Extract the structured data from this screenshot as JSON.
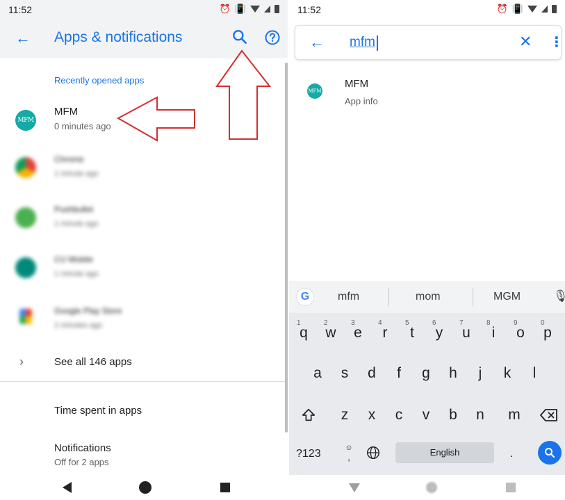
{
  "left_screen": {
    "status_bar": {
      "time": "11:52"
    },
    "app_bar": {
      "title": "Apps & notifications"
    },
    "section_label": "Recently opened apps",
    "recent_apps": [
      {
        "name": "MFM",
        "subtitle": "0 minutes ago",
        "icon": "mfm-icon",
        "icon_text": "MFM",
        "color": "#14aaa6"
      },
      {
        "name": "Chrome",
        "subtitle": "1 minute ago",
        "icon": "chrome-icon",
        "color": "#db4437"
      },
      {
        "name": "Pushbullet",
        "subtitle": "1 minute ago",
        "icon": "pushbullet-icon",
        "color": "#4caf50"
      },
      {
        "name": "CU Mobile",
        "subtitle": "1 minute ago",
        "icon": "cu-mobile-icon",
        "color": "#00897b"
      },
      {
        "name": "Google Play Store",
        "subtitle": "2 minutes ago",
        "icon": "play-store-icon",
        "color": "#01875f"
      }
    ],
    "see_all_label": "See all 146 apps",
    "time_spent_label": "Time spent in apps",
    "notifications": {
      "title": "Notifications",
      "subtitle": "Off for 2 apps"
    }
  },
  "right_screen": {
    "status_bar": {
      "time": "11:52"
    },
    "search": {
      "query": "mfm"
    },
    "result": {
      "name": "MFM",
      "subtitle": "App info",
      "icon_text": "MFM"
    },
    "keyboard": {
      "suggestions": [
        "mfm",
        "mom",
        "MGM"
      ],
      "row1": [
        {
          "key": "q",
          "hint": "1"
        },
        {
          "key": "w",
          "hint": "2"
        },
        {
          "key": "e",
          "hint": "3"
        },
        {
          "key": "r",
          "hint": "4"
        },
        {
          "key": "t",
          "hint": "5"
        },
        {
          "key": "y",
          "hint": "6"
        },
        {
          "key": "u",
          "hint": "7"
        },
        {
          "key": "i",
          "hint": "8"
        },
        {
          "key": "o",
          "hint": "9"
        },
        {
          "key": "p",
          "hint": "0"
        }
      ],
      "row2": [
        "a",
        "s",
        "d",
        "f",
        "g",
        "h",
        "j",
        "k",
        "l"
      ],
      "row3": [
        "z",
        "x",
        "c",
        "v",
        "b",
        "n",
        "m"
      ],
      "symbols_label": "?123",
      "comma_label": ",",
      "period_label": ".",
      "space_label": "English"
    }
  },
  "colors": {
    "accent": "#1a73e8",
    "annotation": "#d32f2f",
    "mfm_teal": "#14aaa6"
  }
}
